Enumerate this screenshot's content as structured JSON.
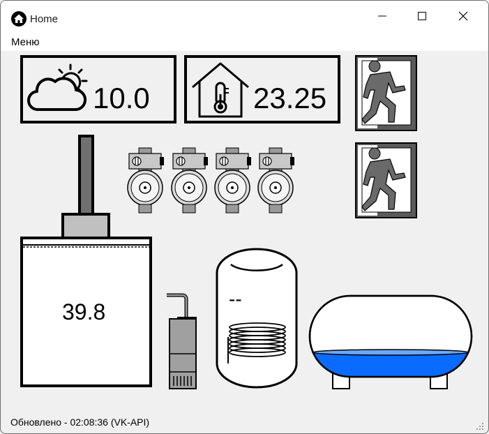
{
  "window": {
    "title": "Home",
    "app_icon": "home-icon",
    "controls": [
      "minimize-icon",
      "maximize-icon",
      "close-icon"
    ]
  },
  "menu": {
    "items": [
      {
        "label": "Меню"
      }
    ]
  },
  "panels": {
    "outdoor": {
      "icon": "weather-cloud-sun-icon",
      "value": "10.0"
    },
    "indoor": {
      "icon": "house-thermometer-icon",
      "value": "23.25"
    },
    "exits": [
      {
        "icon": "exit-running-man-icon"
      },
      {
        "icon": "exit-running-man-icon"
      }
    ]
  },
  "pumps": [
    {
      "icon": "circulation-pump-icon"
    },
    {
      "icon": "circulation-pump-icon"
    },
    {
      "icon": "circulation-pump-icon"
    },
    {
      "icon": "circulation-pump-icon"
    }
  ],
  "boiler": {
    "value": "39.8"
  },
  "water_tank": {
    "value": "--"
  },
  "pool": {
    "icon": "pool-tank-icon",
    "water_color": "#0a6cff"
  },
  "status_bar": {
    "text": "Обновлено - 02:08:36 (VK-API)"
  }
}
